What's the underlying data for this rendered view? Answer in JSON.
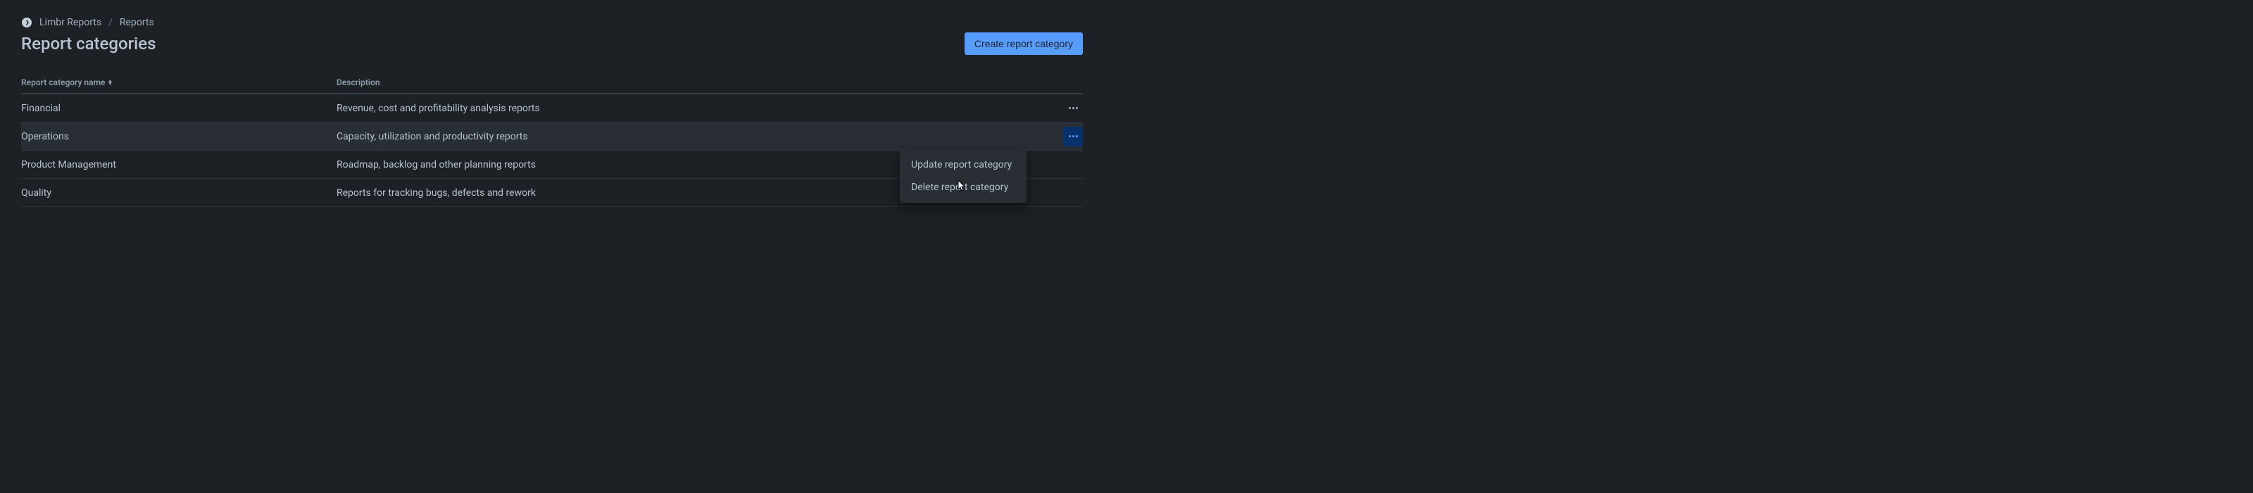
{
  "breadcrumb": {
    "root": "Limbr Reports",
    "current": "Reports"
  },
  "page_title": "Report categories",
  "create_button_label": "Create report category",
  "table": {
    "headers": {
      "name": "Report category name",
      "description": "Description"
    },
    "rows": [
      {
        "name": "Financial",
        "description": "Revenue, cost and profitability analysis reports",
        "hovered": false,
        "menu_open": false
      },
      {
        "name": "Operations",
        "description": "Capacity, utilization and productivity reports",
        "hovered": true,
        "menu_open": true
      },
      {
        "name": "Product Management",
        "description": "Roadmap, backlog and other planning reports",
        "hovered": false,
        "menu_open": false
      },
      {
        "name": "Quality",
        "description": "Reports for tracking bugs, defects and rework",
        "hovered": false,
        "menu_open": false
      }
    ]
  },
  "dropdown": {
    "items": {
      "update": "Update report category",
      "delete": "Delete report category"
    }
  }
}
